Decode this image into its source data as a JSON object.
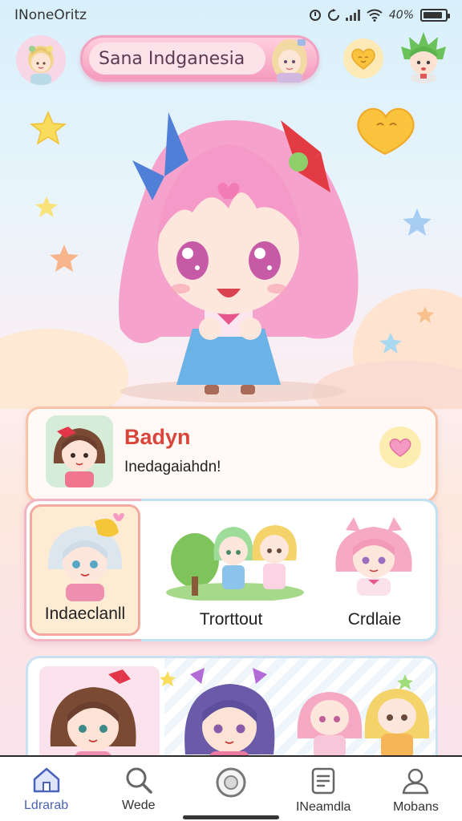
{
  "status_bar": {
    "time": "INoneOritz",
    "battery": "40%",
    "battery_level": 0.9
  },
  "header": {
    "title": "Sana Indganesia",
    "left_avatar_icon": "blonde-girl-avatar",
    "right_avatar_icon": "green-hair-avatar",
    "heart_icon": "yellow-heart-icon"
  },
  "profile": {
    "name": "Badyn",
    "subtitle": "Inedagaiahdn!",
    "favorite_icon": "pink-heart-icon"
  },
  "categories": [
    {
      "label": "Indaeclanll",
      "selected": true
    },
    {
      "label": "Trorttout",
      "selected": false
    },
    {
      "label": "Crdlaie",
      "selected": false
    }
  ],
  "tabs": [
    {
      "label": "Ldrarab",
      "icon": "home-icon",
      "active": true
    },
    {
      "label": "Wede",
      "icon": "search-icon",
      "active": false
    },
    {
      "label": "",
      "icon": "circle-button-icon",
      "active": false
    },
    {
      "label": "INeamdla",
      "icon": "document-icon",
      "active": false
    },
    {
      "label": "Mobans",
      "icon": "profile-icon",
      "active": false
    }
  ],
  "colors": {
    "accent_pink": "#f59bbd",
    "name_red": "#d9453b",
    "active_tab": "#4a63b8"
  }
}
